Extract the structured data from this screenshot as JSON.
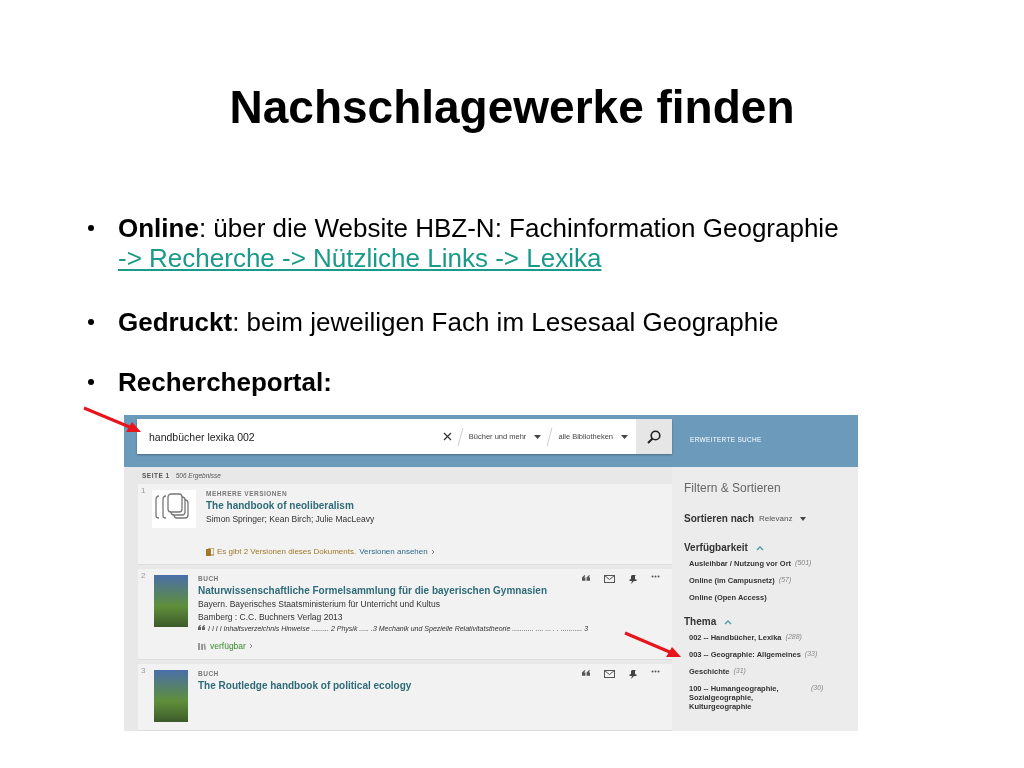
{
  "slide": {
    "title": "Nachschlagewerke finden"
  },
  "bullets": [
    {
      "text": "**Online**: über die Website HBZ-N: Fachinformation Geographie",
      "link": "-> Recherche -> Nützliche Links -> Lexika"
    },
    {
      "text": "**Gedruckt**: beim jeweiligen Fach im Lesesaal Geographie"
    },
    {
      "text": "**Rechercheportal:**"
    }
  ],
  "screenshot": {
    "search": {
      "value": "handbücher lexika 002",
      "scope": "Bücher und mehr",
      "library": "alle Bibliotheken",
      "advanced": "ERWEITERTE SUCHE"
    },
    "results_header": {
      "page": "SEITE 1",
      "count": "506 Ergebnisse"
    },
    "results": [
      {
        "number": "1",
        "kind": "versions",
        "type": "MEHRERE VERSIONEN",
        "title": "The handbook of neoliberalism",
        "lines": [
          "Simon Springer; Kean Birch; Julie MacLeavy"
        ],
        "versions_note": "Es gibt 2 Versionen dieses Dokuments.",
        "versions_link": "Versionen ansehen"
      },
      {
        "number": "2",
        "kind": "book",
        "type": "BUCH",
        "title": "Naturwissenschaftliche Formelsammlung für die bayerischen Gymnasien",
        "lines": [
          "Bayern. Bayerisches Staatsministerium für Unterricht und Kultus",
          "Bamberg : C.C. Buchners Verlag 2013"
        ],
        "snippet": "I I I I Inhaltsverzeichnis Hinweise ......... 2 Physik ..... .3 Mechanik und Spezielle Relativitatstheorie ........... .... ... . . ........... 3",
        "availability": "verfügbar"
      },
      {
        "number": "3",
        "kind": "book",
        "type": "BUCH",
        "title": "The Routledge handbook of political ecology"
      }
    ],
    "sidebar": {
      "heading": "Filtern & Sortieren",
      "sort_label": "Sortieren nach",
      "sort_value": "Relevanz",
      "groups": [
        {
          "name": "Verfügbarkeit",
          "expanded": true,
          "items": [
            {
              "label": "Ausleihbar / Nutzung vor Ort",
              "count": "(501)"
            },
            {
              "label": "Online (im Campusnetz)",
              "count": "(57)"
            },
            {
              "label": "Online (Open Access)"
            }
          ]
        },
        {
          "name": "Thema",
          "expanded": true,
          "items": [
            {
              "label": "002 -- Handbücher, Lexika",
              "count": "(288)"
            },
            {
              "label": "003 -- Geographie: Allgemeines",
              "count": "(33)"
            },
            {
              "label": "Geschichte",
              "count": "(31)"
            },
            {
              "label": "100 -- Humangeographie, Sozialgeographie, Kulturgeographie",
              "count": "(30)"
            }
          ]
        }
      ]
    }
  }
}
